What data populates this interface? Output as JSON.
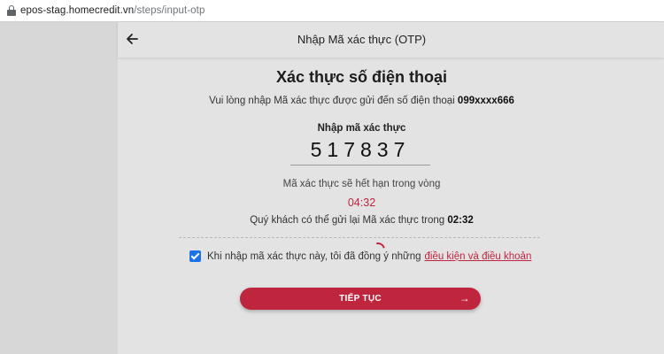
{
  "browser": {
    "url_host": "epos-stag.homecredit.vn",
    "url_path": "/steps/input-otp"
  },
  "header": {
    "title": "Nhập Mã xác thực (OTP)",
    "back_icon": "arrow-left-icon"
  },
  "main": {
    "title": "Xác thực số điện thoại",
    "subtitle_prefix": "Vui lòng nhập Mã xác thực được gửi đến số điện thoại ",
    "phone": "099xxxx666",
    "otp_label": "Nhập mã xác thực",
    "otp_value": "517837",
    "expire_text": "Mã xác thực sẽ hết hạn trong vòng",
    "expire_timer": "04:32",
    "resend_prefix": "Quý khách có thể gửi lại Mã xác thực trong ",
    "resend_timer": "02:32"
  },
  "agreement": {
    "checked": true,
    "text": "Khi nhập mã xác thực này, tôi đã đồng ý những",
    "link_text": "điều kiện và điều khoản"
  },
  "actions": {
    "continue_label": "TIẾP TỤC",
    "continue_icon": "arrow-right-icon"
  },
  "colors": {
    "accent": "#c0253e",
    "checkbox": "#1a73e8"
  }
}
